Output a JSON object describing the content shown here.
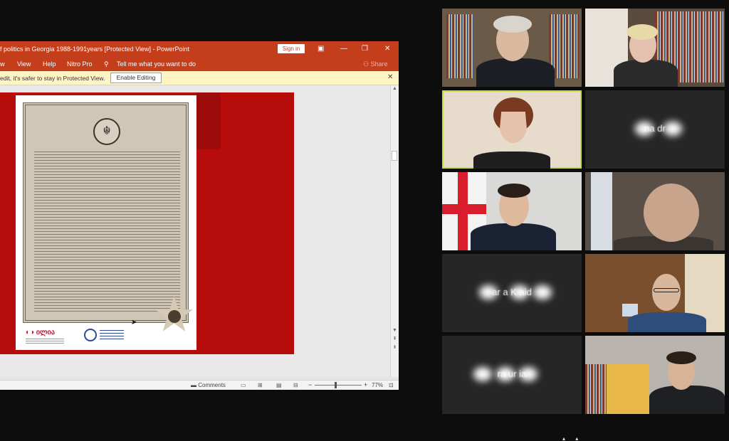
{
  "powerpoint": {
    "window_title": "f politics in Georgia 1988-1991years [Protected View]  -  PowerPoint",
    "signin_label": "Sign in",
    "menu": [
      "w",
      "View",
      "Help",
      "Nitro Pro"
    ],
    "tell_me": "Tell me what you want to do",
    "share_label": "Share",
    "protected_message": "edit, it's safer to stay in Protected View.",
    "enable_editing_label": "Enable Editing",
    "comments_label": "Comments",
    "zoom_level": "77%",
    "zoom_fraction": 0.45,
    "slide_logo_text": "ილია"
  },
  "gallery": {
    "participants": [
      {
        "id": "p1",
        "type": "video",
        "active": false
      },
      {
        "id": "p2",
        "type": "video",
        "active": false
      },
      {
        "id": "p3",
        "type": "video",
        "active": true
      },
      {
        "id": "p4",
        "type": "name",
        "name": "na    dr"
      },
      {
        "id": "p5",
        "type": "video",
        "active": false
      },
      {
        "id": "p6",
        "type": "video",
        "active": false
      },
      {
        "id": "p7",
        "type": "name",
        "name": "ar    a K    aid"
      },
      {
        "id": "p8",
        "type": "video",
        "active": false
      },
      {
        "id": "p9",
        "type": "name",
        "name": "ra          ur    ia"
      },
      {
        "id": "p10",
        "type": "video",
        "active": false
      }
    ]
  },
  "colors": {
    "ppt_accent": "#c43e1c",
    "slide_background": "#b70c0c",
    "active_speaker": "#c9d94a",
    "tile_background": "#262626"
  }
}
